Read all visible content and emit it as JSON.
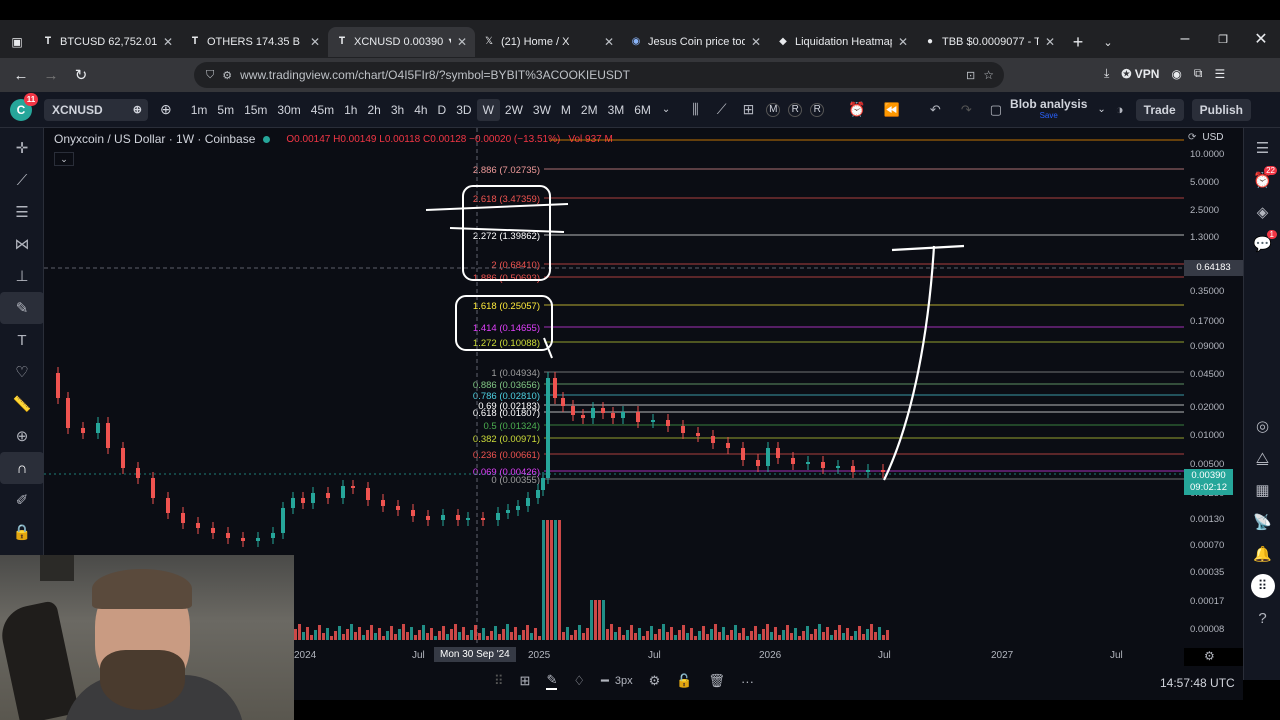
{
  "browser": {
    "tabs": [
      {
        "label": "BTCUSD 62,752.01 ▼ -",
        "icon": "tradingview-icon",
        "active": false
      },
      {
        "label": "OTHERS 174.35 B ▼ -",
        "icon": "tradingview-icon",
        "active": false
      },
      {
        "label": "XCNUSD 0.00390 ▼ -",
        "icon": "tradingview-icon",
        "active": true
      },
      {
        "label": "(21) Home / X",
        "icon": "x-icon",
        "active": false
      },
      {
        "label": "Jesus Coin price today",
        "icon": "coin-icon",
        "active": false
      },
      {
        "label": "Liquidation Heatmap",
        "icon": "heatmap-icon",
        "active": false
      },
      {
        "label": "TBB $0.0009077 - The",
        "icon": "coin-icon",
        "active": false
      }
    ],
    "url": "www.tradingview.com/chart/O4I5FIr8/?symbol=BYBIT%3ACOOKIEUSDT",
    "vpn_label": "VPN"
  },
  "toolbar": {
    "avatar_letter": "C",
    "avatar_badge": "11",
    "symbol": "XCNUSD",
    "timeframes": [
      "1m",
      "5m",
      "15m",
      "30m",
      "45m",
      "1h",
      "2h",
      "3h",
      "4h",
      "D",
      "3D",
      "W",
      "2W",
      "3W",
      "M",
      "2M",
      "3M",
      "6M"
    ],
    "selected_timeframe": "W",
    "layout_name": "Blob analysis",
    "layout_sub": "Save",
    "trade_label": "Trade",
    "publish_label": "Publish"
  },
  "chart_header": {
    "title": "Onyxcoin / US Dollar · 1W · Coinbase",
    "ohlc": "O0.00147 H0.00149 L0.00118 C0.00128 −0.00020 (−13.51%)",
    "vol": "Vol 937 M",
    "currency": "USD"
  },
  "fib_levels": [
    {
      "label": "2.886 (7.02735)",
      "color": "#ef9a9a"
    },
    {
      "label": "2.618 (3.47359)",
      "color": "#ef5350"
    },
    {
      "label": "2.272 (1.39862)",
      "color": "#ffffff"
    },
    {
      "label": "2 (0.68410)",
      "color": "#ef5350"
    },
    {
      "label": "1.886 (0.50693)",
      "color": "#ef5350"
    },
    {
      "label": "1.618 (0.25057)",
      "color": "#ffeb3b"
    },
    {
      "label": "1.414 (0.14655)",
      "color": "#e040fb"
    },
    {
      "label": "1.272 (0.10088)",
      "color": "#cddc39"
    },
    {
      "label": "1 (0.04934)",
      "color": "#9e9e9e"
    },
    {
      "label": "0.886 (0.03656)",
      "color": "#81c784"
    },
    {
      "label": "0.786 (0.02810)",
      "color": "#4dd0e1"
    },
    {
      "label": "0.69 (0.02183)",
      "color": "#ffffff"
    },
    {
      "label": "0.618 (0.01807)",
      "color": "#ffffff"
    },
    {
      "label": "0.5 (0.01324)",
      "color": "#4caf50"
    },
    {
      "label": "0.382 (0.00971)",
      "color": "#cddc39"
    },
    {
      "label": "0.236 (0.00661)",
      "color": "#ef5350"
    },
    {
      "label": "0.069 (0.00426)",
      "color": "#e040fb"
    },
    {
      "label": "0 (0.00355)",
      "color": "#9e9e9e"
    }
  ],
  "price_axis": {
    "ticks": [
      "10.0000",
      "5.0000",
      "2.5000",
      "1.3000",
      "0.35000",
      "0.17000",
      "0.09000",
      "0.04500",
      "0.02000",
      "0.01000",
      "0.00500",
      "0.00250",
      "0.00130",
      "0.00070",
      "0.00035",
      "0.00017",
      "0.00008"
    ],
    "crosshair_label": "0.64183",
    "current_price": "0.00390",
    "countdown": "09:02:12"
  },
  "time_axis": {
    "ticks": [
      "2024",
      "Jul",
      "2025",
      "Jul",
      "2026",
      "Jul",
      "2027",
      "Jul"
    ],
    "crosshair_date": "Mon 30 Sep '24"
  },
  "drawing_toolbar": {
    "stroke_width": "3px"
  },
  "clock": "14:57:48 UTC",
  "right_sidebar": {
    "alerts_badge": "22",
    "notif_badge": "1"
  }
}
